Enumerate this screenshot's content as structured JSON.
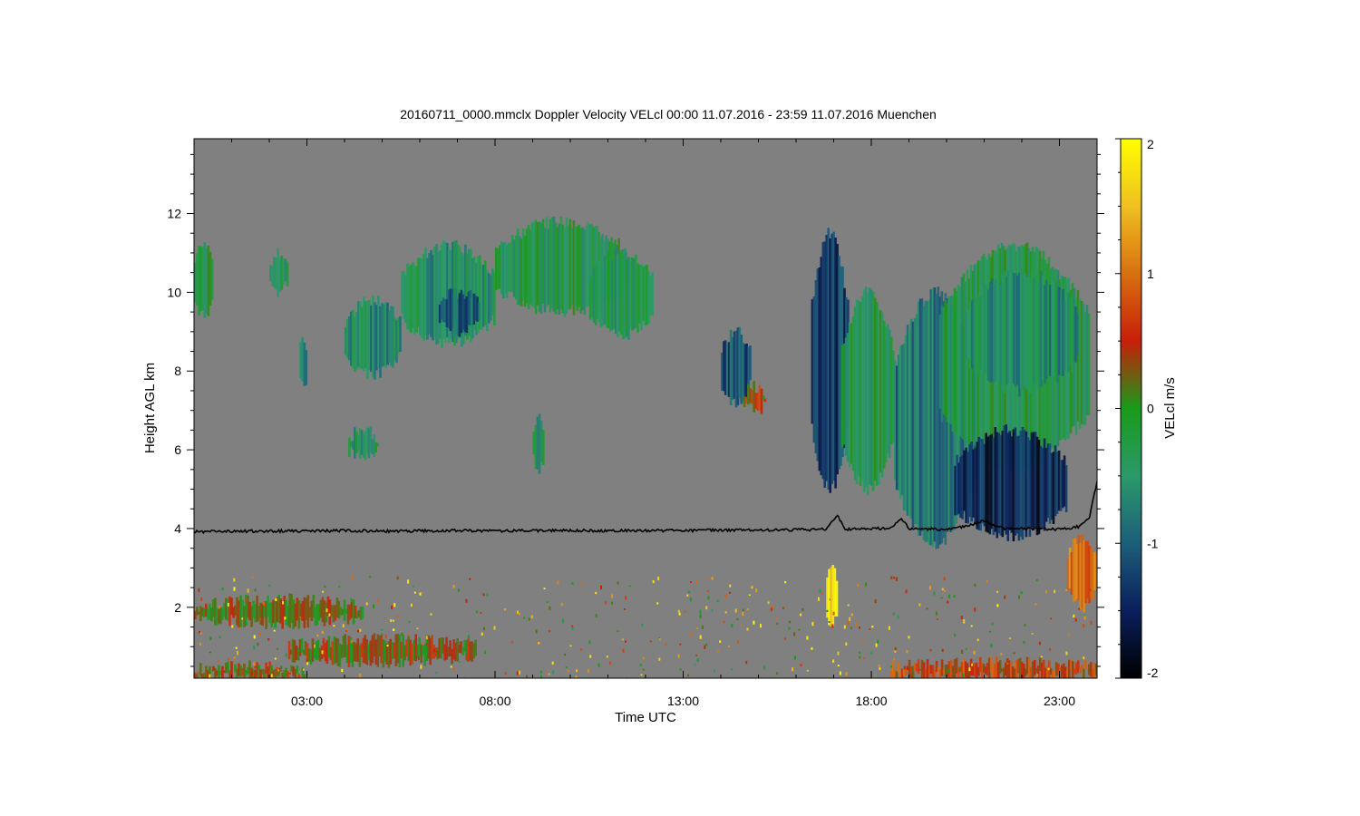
{
  "chart_data": {
    "type": "heatmap",
    "title": "20160711_0000.mmclx Doppler Velocity VELcl   00:00 11.07.2016 - 23:59 11.07.2016 Muenchen",
    "xlabel": "Time UTC",
    "ylabel": "Height AGL km",
    "xlim": [
      0,
      24
    ],
    "ylim": [
      0.2,
      13.9
    ],
    "x_ticks": [
      {
        "value": 3,
        "label": "03:00"
      },
      {
        "value": 8,
        "label": "08:00"
      },
      {
        "value": 13,
        "label": "13:00"
      },
      {
        "value": 18,
        "label": "18:00"
      },
      {
        "value": 23,
        "label": "23:00"
      }
    ],
    "y_ticks": [
      {
        "value": 2,
        "label": "2"
      },
      {
        "value": 4,
        "label": "4"
      },
      {
        "value": 6,
        "label": "6"
      },
      {
        "value": 8,
        "label": "8"
      },
      {
        "value": 10,
        "label": "10"
      },
      {
        "value": 12,
        "label": "12"
      }
    ],
    "background_color": "#808080",
    "colorbar": {
      "label": "VELcl m/s",
      "range": [
        -2,
        2
      ],
      "ticks": [
        {
          "value": 2,
          "label": "2"
        },
        {
          "value": 1,
          "label": "1"
        },
        {
          "value": 0,
          "label": "0"
        },
        {
          "value": -1,
          "label": "-1"
        },
        {
          "value": -2,
          "label": "-2"
        }
      ],
      "stops": [
        {
          "value": -2,
          "color": "#000000"
        },
        {
          "value": -1.5,
          "color": "#0a1f5c"
        },
        {
          "value": -1,
          "color": "#1c5e7a"
        },
        {
          "value": -0.5,
          "color": "#2a9a6a"
        },
        {
          "value": 0,
          "color": "#1a9a1a"
        },
        {
          "value": 0.5,
          "color": "#c81e0a"
        },
        {
          "value": 1,
          "color": "#d87010"
        },
        {
          "value": 1.5,
          "color": "#f0c020"
        },
        {
          "value": 2,
          "color": "#ffff00"
        }
      ]
    },
    "cloud_regions": [
      {
        "t0": 0.0,
        "t1": 0.5,
        "h0": 9.4,
        "h1": 11.2,
        "v": -0.3
      },
      {
        "t0": 2.0,
        "t1": 2.5,
        "h0": 10.0,
        "h1": 11.0,
        "v": -0.3
      },
      {
        "t0": 4.0,
        "t1": 5.5,
        "h0": 7.9,
        "h1": 9.8,
        "v": -0.6
      },
      {
        "t0": 5.5,
        "t1": 8.0,
        "h0": 8.7,
        "h1": 11.2,
        "v": -0.5
      },
      {
        "t0": 6.5,
        "t1": 7.6,
        "h0": 9.0,
        "h1": 10.0,
        "v": -1.0
      },
      {
        "t0": 8.0,
        "t1": 11.5,
        "h0": 9.5,
        "h1": 11.8,
        "v": -0.3
      },
      {
        "t0": 10.5,
        "t1": 12.2,
        "h0": 8.9,
        "h1": 11.0,
        "v": -0.4
      },
      {
        "t0": 4.1,
        "t1": 4.9,
        "h0": 5.8,
        "h1": 6.5,
        "v": -0.4
      },
      {
        "t0": 9.0,
        "t1": 9.3,
        "h0": 5.5,
        "h1": 6.8,
        "v": -0.5
      },
      {
        "t0": 2.8,
        "t1": 3.0,
        "h0": 7.6,
        "h1": 8.8,
        "v": -0.6
      },
      {
        "t0": 14.0,
        "t1": 14.8,
        "h0": 7.2,
        "h1": 9.0,
        "v": -1.1
      },
      {
        "t0": 14.6,
        "t1": 15.2,
        "h0": 7.0,
        "h1": 7.6,
        "v": 0.4
      },
      {
        "t0": 16.4,
        "t1": 17.4,
        "h0": 5.0,
        "h1": 11.5,
        "v": -1.3
      },
      {
        "t0": 17.2,
        "t1": 18.6,
        "h0": 5.0,
        "h1": 10.0,
        "v": -0.3
      },
      {
        "t0": 18.6,
        "t1": 20.8,
        "h0": 3.6,
        "h1": 10.0,
        "v": -0.8
      },
      {
        "t0": 19.8,
        "t1": 23.8,
        "h0": 5.5,
        "h1": 11.2,
        "v": -0.3
      },
      {
        "t0": 20.2,
        "t1": 23.2,
        "h0": 3.8,
        "h1": 6.5,
        "v": -1.5
      },
      {
        "t0": 20.5,
        "t1": 23.5,
        "h0": 7.5,
        "h1": 10.5,
        "v": -0.6
      },
      {
        "t0": 23.2,
        "t1": 24.0,
        "h0": 2.0,
        "h1": 3.8,
        "v": 1.0
      },
      {
        "t0": 16.8,
        "t1": 17.1,
        "h0": 1.6,
        "h1": 3.0,
        "v": 1.8
      },
      {
        "t0": 0.0,
        "t1": 4.5,
        "h0": 1.6,
        "h1": 2.2,
        "v": 0.2
      },
      {
        "t0": 2.5,
        "t1": 7.5,
        "h0": 0.6,
        "h1": 1.2,
        "v": 0.3
      },
      {
        "t0": 0.0,
        "t1": 3.0,
        "h0": 0.2,
        "h1": 0.5,
        "v": 0.3
      },
      {
        "t0": 18.5,
        "t1": 24.0,
        "h0": 0.2,
        "h1": 0.6,
        "v": 0.6
      }
    ],
    "line_series": {
      "name": "",
      "color": "#000000",
      "points": [
        [
          0,
          3.92
        ],
        [
          1,
          3.93
        ],
        [
          2,
          3.94
        ],
        [
          3,
          3.93
        ],
        [
          4,
          3.95
        ],
        [
          5,
          3.93
        ],
        [
          6,
          3.94
        ],
        [
          7,
          3.95
        ],
        [
          8,
          3.94
        ],
        [
          9,
          3.95
        ],
        [
          10,
          3.95
        ],
        [
          11,
          3.94
        ],
        [
          12,
          3.95
        ],
        [
          13,
          3.95
        ],
        [
          14,
          3.96
        ],
        [
          15,
          3.96
        ],
        [
          16,
          3.97
        ],
        [
          16.8,
          3.98
        ],
        [
          17.1,
          4.35
        ],
        [
          17.3,
          3.98
        ],
        [
          18,
          4.0
        ],
        [
          18.5,
          4.0
        ],
        [
          18.8,
          4.25
        ],
        [
          19.0,
          4.0
        ],
        [
          20,
          3.98
        ],
        [
          20.5,
          4.05
        ],
        [
          21,
          4.2
        ],
        [
          21.5,
          4.0
        ],
        [
          22,
          4.0
        ],
        [
          23,
          3.98
        ],
        [
          23.5,
          4.05
        ],
        [
          23.8,
          4.3
        ],
        [
          24,
          5.2
        ]
      ]
    }
  }
}
